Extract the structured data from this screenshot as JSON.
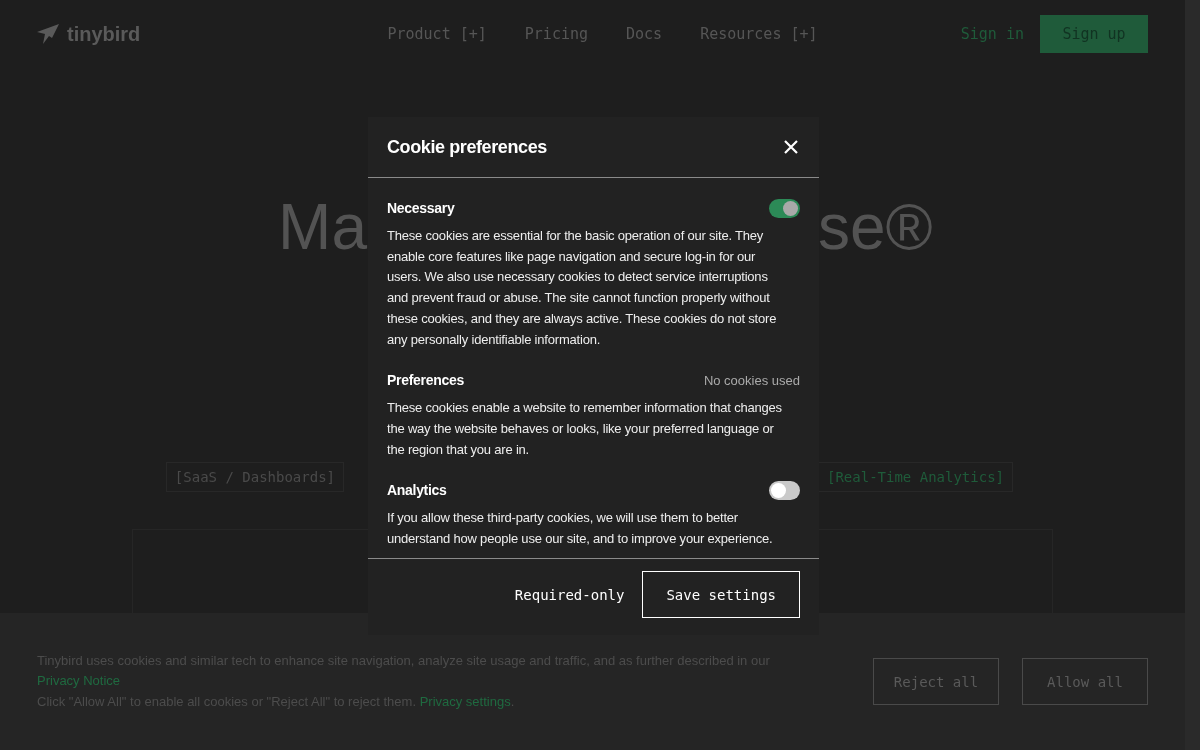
{
  "header": {
    "logo": "tinybird",
    "nav": [
      {
        "label": "Product [+]"
      },
      {
        "label": "Pricing"
      },
      {
        "label": "Docs"
      },
      {
        "label": "Resources [+]"
      }
    ],
    "sign_in": "Sign in",
    "sign_up": "Sign up"
  },
  "hero": {
    "heading_left": "Ma",
    "heading_right": "se®",
    "tag_left": "[SaaS / Dashboards]",
    "tag_right": "[Real-Time Analytics]"
  },
  "modal": {
    "title": "Cookie preferences",
    "sections": [
      {
        "kind": "toggle",
        "title": "Necessary",
        "on": true,
        "text": "These cookies are essential for the basic operation of our site. They enable core features like page navigation and secure log-in for our users. We also use necessary cookies to detect service interruptions and prevent fraud or abuse. The site cannot function properly without these cookies, and they are always active. These cookies do not store any personally identifiable information."
      },
      {
        "kind": "status",
        "title": "Preferences",
        "status": "No cookies used",
        "text": "These cookies enable a website to remember information that changes the way the website behaves or looks, like your preferred language or the region that you are in."
      },
      {
        "kind": "toggle",
        "title": "Analytics",
        "on": false,
        "text": "If you allow these third-party cookies, we will use them to better understand how people use our site, and to improve your experience."
      }
    ],
    "buttons": [
      {
        "label": "Required-only",
        "kind": "plain"
      },
      {
        "label": "Save settings",
        "kind": "outlined"
      }
    ]
  },
  "banner": {
    "text": "Tinybird uses cookies and similar tech to enhance site navigation, analyze site usage and traffic, and as further described in our",
    "link": "Privacy Notice",
    "text2": "Click \"Allow All\" to enable all cookies or \"Reject All\" to reject them.",
    "link2": "Privacy settings",
    "end": ".",
    "buttons": [
      "Reject all",
      "Allow all"
    ]
  }
}
